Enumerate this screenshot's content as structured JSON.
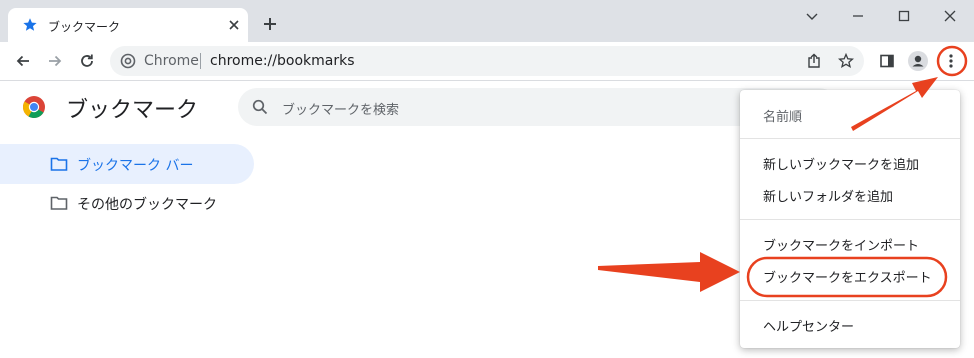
{
  "tab": {
    "title": "ブックマーク",
    "icon": "star-icon",
    "close_icon": "close-icon"
  },
  "window_controls": [
    "chevron-down-icon",
    "minimize-icon",
    "maximize-icon",
    "close-icon"
  ],
  "omnibox": {
    "site_chip": "Chrome",
    "url": "chrome://bookmarks"
  },
  "page": {
    "title": "ブックマーク",
    "search": {
      "placeholder": "ブックマークを検索"
    }
  },
  "sidebar": {
    "items": [
      {
        "label": "ブックマーク バー",
        "selected": true
      },
      {
        "label": "その他のブックマーク",
        "selected": false
      }
    ]
  },
  "menu": {
    "items": [
      {
        "label": "名前順",
        "disabled": true
      },
      {
        "label": "新しいブックマークを追加"
      },
      {
        "label": "新しいフォルダを追加"
      },
      {
        "label": "ブックマークをインポート"
      },
      {
        "label": "ブックマークをエクスポート",
        "highlighted": true
      },
      {
        "label": "ヘルプセンター"
      }
    ]
  },
  "colors": {
    "accent": "#1a73e8",
    "annotation": "#e8411f"
  }
}
